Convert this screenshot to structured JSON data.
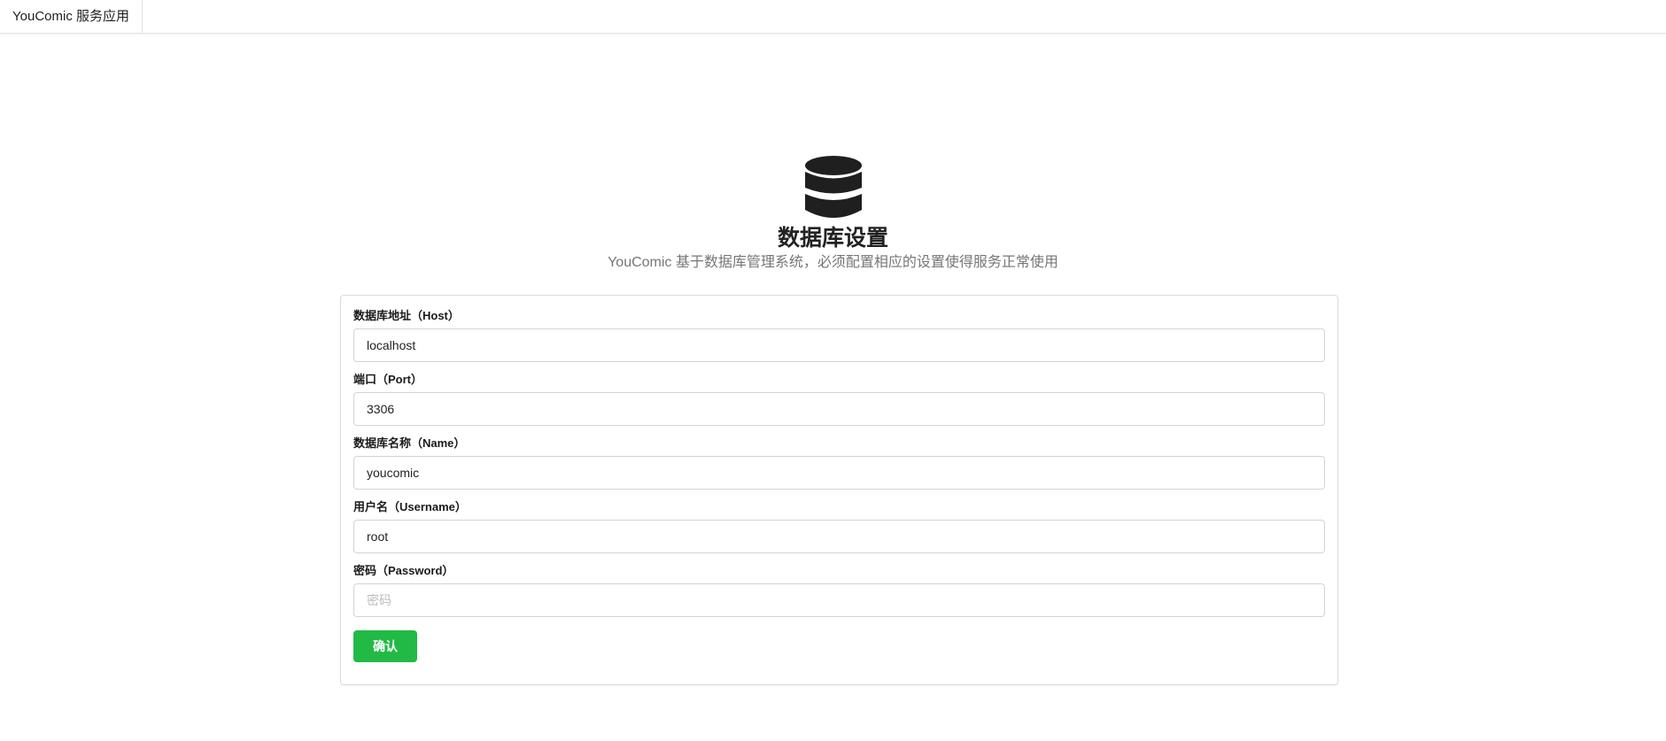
{
  "app": {
    "brand": "YouComic 服务应用"
  },
  "hero": {
    "icon": "database-icon",
    "title": "数据库设置",
    "subtitle": "YouComic 基于数据库管理系统，必须配置相应的设置使得服务正常使用"
  },
  "form": {
    "fields": [
      {
        "label": "数据库地址（Host）",
        "value": "localhost",
        "placeholder": ""
      },
      {
        "label": "端口（Port）",
        "value": "3306",
        "placeholder": ""
      },
      {
        "label": "数据库名称（Name）",
        "value": "youcomic",
        "placeholder": ""
      },
      {
        "label": "用户名（Username）",
        "value": "root",
        "placeholder": ""
      },
      {
        "label": "密码（Password）",
        "value": "",
        "placeholder": "密码"
      }
    ],
    "submit_label": "确认"
  },
  "colors": {
    "accent": "#21ba45",
    "icon": "#1f1f1f"
  }
}
